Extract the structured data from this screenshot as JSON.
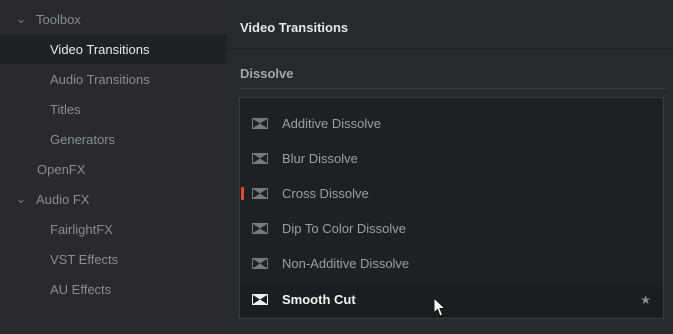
{
  "sidebar": {
    "items": [
      {
        "label": "Toolbox",
        "expandable": true
      },
      {
        "label": "Video Transitions",
        "selected": true
      },
      {
        "label": "Audio Transitions"
      },
      {
        "label": "Titles"
      },
      {
        "label": "Generators"
      },
      {
        "label": "OpenFX"
      },
      {
        "label": "Audio FX",
        "expandable": true
      },
      {
        "label": "FairlightFX"
      },
      {
        "label": "VST Effects"
      },
      {
        "label": "AU Effects"
      }
    ]
  },
  "panel": {
    "title": "Video Transitions",
    "group_title": "Dissolve",
    "items": [
      {
        "label": "Additive Dissolve"
      },
      {
        "label": "Blur Dissolve"
      },
      {
        "label": "Cross Dissolve",
        "marker": true
      },
      {
        "label": "Dip To Color Dissolve"
      },
      {
        "label": "Non-Additive Dissolve"
      },
      {
        "label": "Smooth Cut",
        "selected": true,
        "star": "★"
      }
    ]
  },
  "colors": {
    "background": "#2a2a2d",
    "sidebar_selected": "#202123",
    "list_background": "#1f2022",
    "marker": "#e5483a"
  },
  "icons": {
    "expand": "chevron-down-icon",
    "transition": "transition-icon",
    "favorite": "star-icon",
    "pointer": "mouse-cursor-icon"
  }
}
